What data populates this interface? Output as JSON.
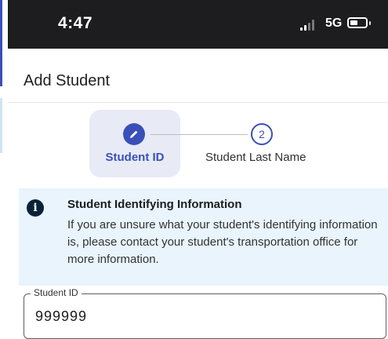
{
  "status_bar": {
    "time": "4:47",
    "network": "5G",
    "battery_level": 0.35
  },
  "page": {
    "title": "Add Student"
  },
  "stepper": {
    "steps": [
      {
        "label": "Student ID",
        "state": "active",
        "icon": "pencil-icon"
      },
      {
        "label": "Student Last Name",
        "state": "pending",
        "number": "2"
      }
    ],
    "accent_color": "#3a50b8"
  },
  "info": {
    "title": "Student Identifying Information",
    "body": "If you are unsure what your student's identifying information is, please contact your student's transportation office for more information.",
    "icon": "info-icon"
  },
  "form": {
    "student_id_label": "Student ID",
    "student_id_value": "999999"
  }
}
